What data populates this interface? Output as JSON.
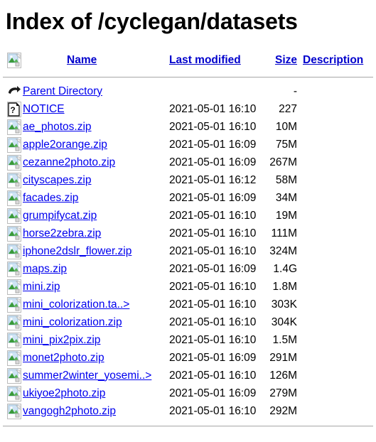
{
  "page": {
    "title": "Index of /cyclegan/datasets"
  },
  "table": {
    "header_icon": "image-file-icon",
    "columns": [
      {
        "label": "Name",
        "key": "name"
      },
      {
        "label": "Last modified",
        "key": "last_modified"
      },
      {
        "label": "Size",
        "key": "size"
      },
      {
        "label": "Description",
        "key": "description"
      }
    ],
    "rows": [
      {
        "icon": "parent-directory-icon",
        "name": "Parent Directory",
        "last_modified": "",
        "size": "-",
        "description": ""
      },
      {
        "icon": "unknown-file-icon",
        "name": "NOTICE",
        "last_modified": "2021-05-01 16:10",
        "size": "227",
        "description": ""
      },
      {
        "icon": "image-file-icon",
        "name": "ae_photos.zip",
        "last_modified": "2021-05-01 16:10",
        "size": "10M",
        "description": ""
      },
      {
        "icon": "image-file-icon",
        "name": "apple2orange.zip",
        "last_modified": "2021-05-01 16:09",
        "size": "75M",
        "description": ""
      },
      {
        "icon": "image-file-icon",
        "name": "cezanne2photo.zip",
        "last_modified": "2021-05-01 16:09",
        "size": "267M",
        "description": ""
      },
      {
        "icon": "image-file-icon",
        "name": "cityscapes.zip",
        "last_modified": "2021-05-01 16:12",
        "size": "58M",
        "description": ""
      },
      {
        "icon": "image-file-icon",
        "name": "facades.zip",
        "last_modified": "2021-05-01 16:09",
        "size": "34M",
        "description": ""
      },
      {
        "icon": "image-file-icon",
        "name": "grumpifycat.zip",
        "last_modified": "2021-05-01 16:10",
        "size": "19M",
        "description": ""
      },
      {
        "icon": "image-file-icon",
        "name": "horse2zebra.zip",
        "last_modified": "2021-05-01 16:10",
        "size": "111M",
        "description": ""
      },
      {
        "icon": "image-file-icon",
        "name": "iphone2dslr_flower.zip",
        "last_modified": "2021-05-01 16:10",
        "size": "324M",
        "description": ""
      },
      {
        "icon": "image-file-icon",
        "name": "maps.zip",
        "last_modified": "2021-05-01 16:09",
        "size": "1.4G",
        "description": ""
      },
      {
        "icon": "image-file-icon",
        "name": "mini.zip",
        "last_modified": "2021-05-01 16:10",
        "size": "1.8M",
        "description": ""
      },
      {
        "icon": "image-file-icon",
        "name": "mini_colorization.ta..>",
        "last_modified": "2021-05-01 16:10",
        "size": "303K",
        "description": ""
      },
      {
        "icon": "image-file-icon",
        "name": "mini_colorization.zip",
        "last_modified": "2021-05-01 16:10",
        "size": "304K",
        "description": ""
      },
      {
        "icon": "image-file-icon",
        "name": "mini_pix2pix.zip",
        "last_modified": "2021-05-01 16:10",
        "size": "1.5M",
        "description": ""
      },
      {
        "icon": "image-file-icon",
        "name": "monet2photo.zip",
        "last_modified": "2021-05-01 16:09",
        "size": "291M",
        "description": ""
      },
      {
        "icon": "image-file-icon",
        "name": "summer2winter_yosemi..>",
        "last_modified": "2021-05-01 16:10",
        "size": "126M",
        "description": ""
      },
      {
        "icon": "image-file-icon",
        "name": "ukiyoe2photo.zip",
        "last_modified": "2021-05-01 16:09",
        "size": "279M",
        "description": ""
      },
      {
        "icon": "image-file-icon",
        "name": "vangogh2photo.zip",
        "last_modified": "2021-05-01 16:10",
        "size": "292M",
        "description": ""
      }
    ]
  },
  "colors": {
    "link": "#0000ee",
    "header_link": "#0000cc",
    "text": "#000000",
    "rule": "#b0b0b0",
    "icon_green": "#339933",
    "icon_sky": "#aaccee"
  }
}
